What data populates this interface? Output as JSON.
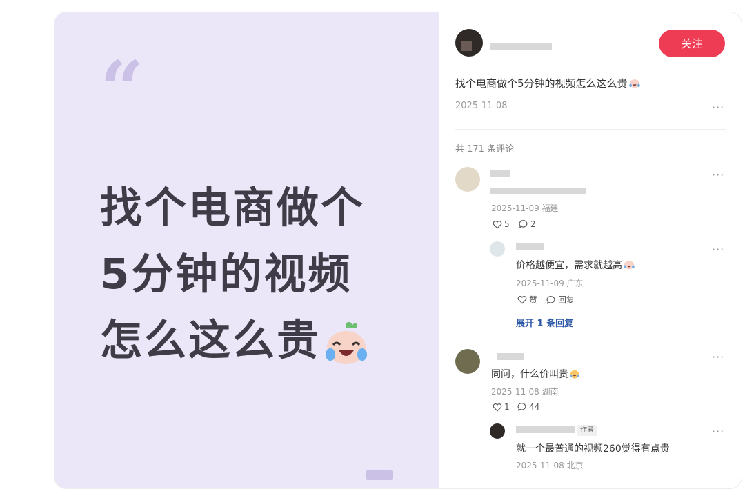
{
  "media": {
    "quote_mark": "“",
    "headline_lines": [
      "找个电商做个",
      "5分钟的视频",
      "怎么这么贵"
    ],
    "emoji": "crying-laughing-face-emoji"
  },
  "post": {
    "follow_label": "关注",
    "title": "找个电商做个5分钟的视频怎么这么贵",
    "date": "2025-11-08",
    "more": "···"
  },
  "comments": {
    "count_label": "共 171 条评论",
    "items": [
      {
        "meta": "2025-11-09 福建",
        "likes": "5",
        "replies": "2",
        "reply": {
          "text": "价格越便宜，需求就越高",
          "meta": "2025-11-09 广东",
          "like_label": "赞",
          "reply_label": "回复"
        },
        "expand_label": "展开 1 条回复"
      },
      {
        "text": "同问，什么价叫贵",
        "meta": "2025-11-08 湖南",
        "likes": "1",
        "replies": "44",
        "reply": {
          "badge": "作者",
          "text": "就一个最普通的视频260觉得有点贵",
          "meta": "2025-11-08 北京"
        }
      }
    ]
  },
  "colors": {
    "accent": "#ef3c55",
    "media_bg": "#ebe7f8",
    "link": "#2f5aa8"
  }
}
